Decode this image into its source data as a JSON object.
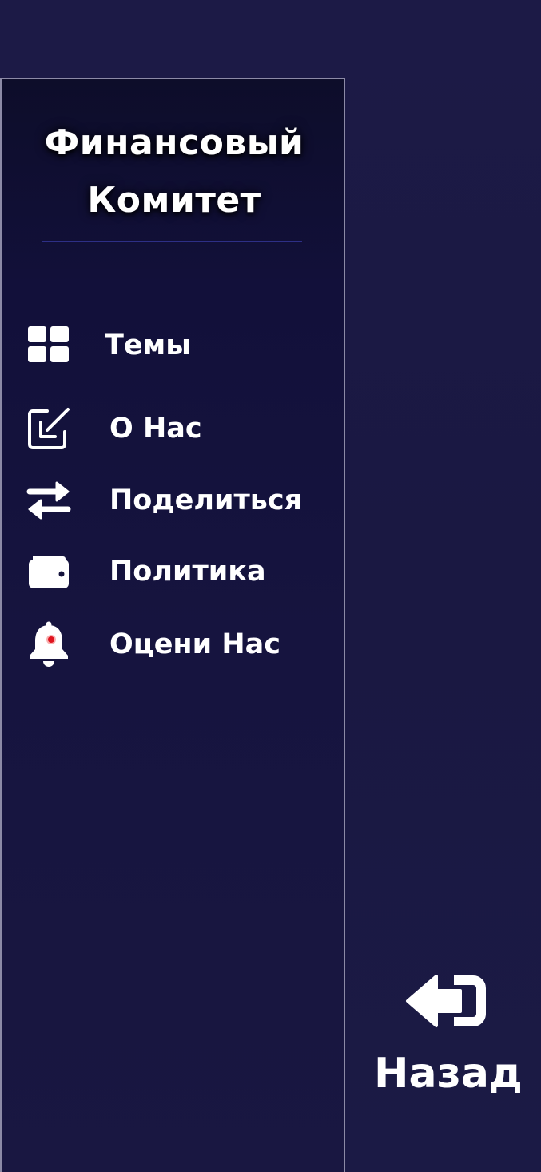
{
  "drawer": {
    "title_line1": "Финансовый",
    "title_line2": "Комитет",
    "items": [
      {
        "label": "Темы",
        "icon": "grid-icon"
      },
      {
        "label": "О Нас",
        "icon": "edit-square-icon"
      },
      {
        "label": "Поделиться",
        "icon": "swap-arrows-icon"
      },
      {
        "label": "Политика",
        "icon": "wallet-icon"
      },
      {
        "label": "Оцени Нас",
        "icon": "bell-icon"
      }
    ]
  },
  "back": {
    "label": "Назад",
    "icon": "back-exit-icon"
  },
  "colors": {
    "background": "#1b1a45",
    "drawer_border": "#8c8aa6",
    "divider": "#2d2f86",
    "text": "#ffffff",
    "notification_dot": "#e0141e"
  }
}
